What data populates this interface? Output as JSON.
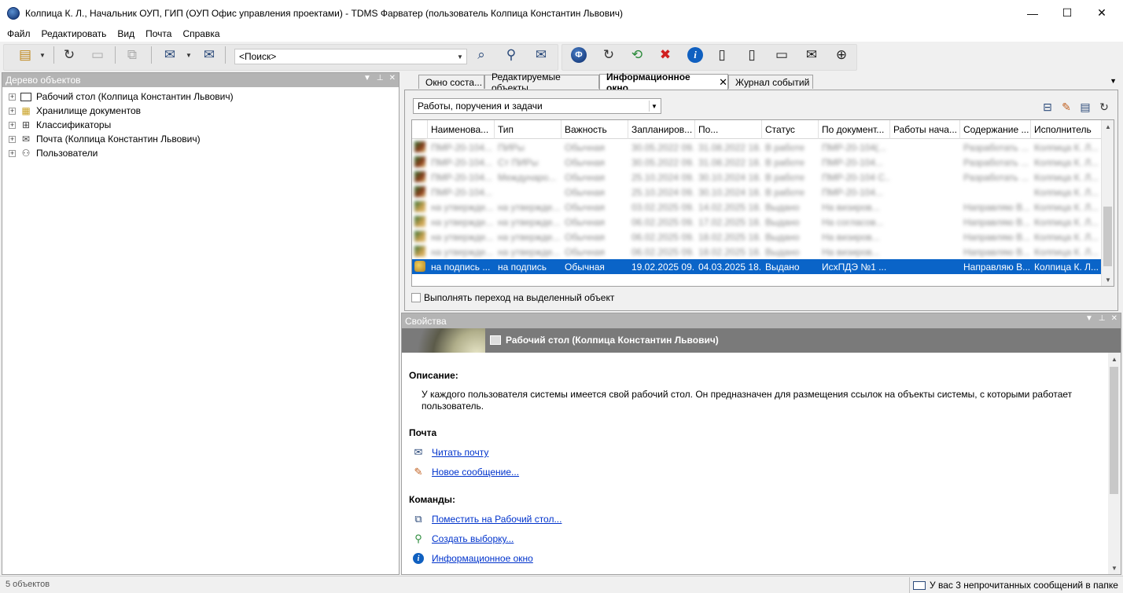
{
  "window": {
    "title": "Колпица К. Л., Начальник ОУП, ГИП (ОУП Офис управления проектами) - TDMS Фарватер (пользователь Колпица Константин Львович)",
    "minimize": "—",
    "maximize": "☐",
    "close": "✕"
  },
  "menu": [
    "Файл",
    "Редактировать",
    "Вид",
    "Почта",
    "Справка"
  ],
  "toolbar": {
    "search_placeholder": "<Поиск>"
  },
  "left_panel": {
    "title": "Дерево объектов",
    "tree": [
      {
        "label": "Рабочий стол (Колпица Константин Львович)",
        "icon": "desktop-icon",
        "selected": true
      },
      {
        "label": "Хранилище документов",
        "icon": "storage-icon"
      },
      {
        "label": "Классификаторы",
        "icon": "classifier-icon"
      },
      {
        "label": "Почта (Колпица Константин Львович)",
        "icon": "mail-icon"
      },
      {
        "label": "Пользователи",
        "icon": "users-icon"
      }
    ]
  },
  "tabs": [
    {
      "label": "Окно соста..."
    },
    {
      "label": "Редактируемые объекты"
    },
    {
      "label": "Информационное окно",
      "active": true
    },
    {
      "label": "Журнал событий"
    }
  ],
  "info_window": {
    "filter": "Работы, поручения и задачи",
    "columns": [
      "Наименова...",
      "Тип",
      "Важность",
      "Запланиров...",
      "По...",
      "Статус",
      "По документ...",
      "Работы нача...",
      "Содержание ...",
      "Исполнитель"
    ],
    "blurred_rows": [
      [
        "ПМР-20-104...",
        "ПИРы",
        "Обычная",
        "30.05.2022 09...",
        "31.08.2022 18...",
        "В работе",
        "ПМР-20-104(...",
        "",
        "Разработать ...",
        "Колпица К. Л..."
      ],
      [
        "ПМР-20-104...",
        "Ст ПИРы",
        "Обычная",
        "30.05.2022 09...",
        "31.08.2022 18...",
        "В работе",
        "ПМР-20-104...",
        "",
        "Разработать ...",
        "Колпица К. Л..."
      ],
      [
        "ПМР-20-104...",
        "Междунаро...",
        "Обычная",
        "25.10.2024 09...",
        "30.10.2024 18...",
        "В работе",
        "ПМР-20-104 С...",
        "",
        "Разработать ...",
        "Колпица К. Л..."
      ],
      [
        "ПМР-20-104...",
        "",
        "Обычная",
        "25.10.2024 09...",
        "30.10.2024 18...",
        "В работе",
        "ПМР-20-104...",
        "",
        "",
        "Колпица К. Л..."
      ],
      [
        "на утвержде...",
        "на утвержде...",
        "Обычная",
        "03.02.2025 09...",
        "14.02.2025 18...",
        "Выдано",
        "На визиров...",
        "",
        "Направляю В...",
        "Колпица К. Л..."
      ],
      [
        "на утвержде...",
        "на утвержде...",
        "Обычная",
        "06.02.2025 09...",
        "17.02.2025 18...",
        "Выдано",
        "На согласов...",
        "",
        "Направляю В...",
        "Колпица К. Л..."
      ],
      [
        "на утвержде...",
        "на утвержде...",
        "Обычная",
        "06.02.2025 09...",
        "18.02.2025 18...",
        "Выдано",
        "На визиров...",
        "",
        "Направляю В...",
        "Колпица К. Л..."
      ],
      [
        "на утвержде...",
        "на утвержде...",
        "Обычная",
        "06.02.2025 09...",
        "18.02.2025 18...",
        "Выдано",
        "На визиров...",
        "",
        "Направляю В...",
        "Колпица К. Л..."
      ]
    ],
    "selected_row": [
      "на подпись ...",
      "на подпись",
      "Обычная",
      "19.02.2025 09...",
      "04.03.2025 18...",
      "Выдано",
      "ИсхПДЭ №1 ...",
      "",
      "Направляю В...",
      "Колпица К. Л..."
    ],
    "checkbox_label": "Выполнять переход на выделенный объект"
  },
  "properties": {
    "title": "Свойства",
    "object_title": "Рабочий стол (Колпица Константин Львович)",
    "description_heading": "Описание:",
    "description": "У каждого пользователя системы имеется свой рабочий стол. Он предназначен для размещения ссылок на объекты системы, с которыми работает пользователь.",
    "mail_heading": "Почта",
    "mail_links": [
      "Читать почту",
      "Новое сообщение..."
    ],
    "commands_heading": "Команды:",
    "command_links": [
      "Поместить на Рабочий стол...",
      "Создать выборку...",
      "Информационное окно"
    ]
  },
  "status": {
    "objects": "5 объектов",
    "unread": "У вас 3 непрочитанных сообщений в папке"
  },
  "colors": {
    "selection": "#0a64c8",
    "panel_header": "#b4b4b4",
    "banner": "#7a7a7a",
    "link": "#0033cc",
    "tab_marker": "#e02020"
  }
}
